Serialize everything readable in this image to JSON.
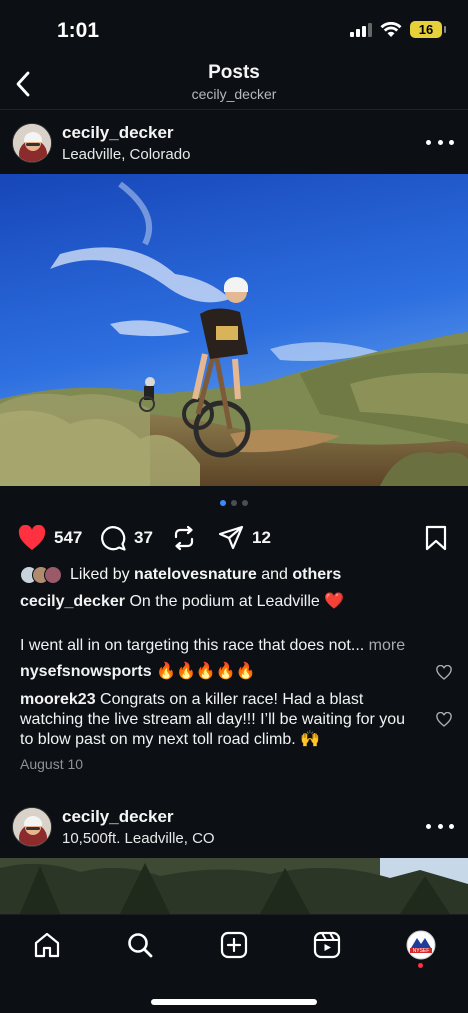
{
  "status": {
    "time": "1:01",
    "battery": "16"
  },
  "header": {
    "title": "Posts",
    "subtitle": "cecily_decker"
  },
  "post1": {
    "author": "cecily_decker",
    "location": "Leadville, Colorado",
    "carousel": {
      "count": 3,
      "active": 1
    },
    "likes_count": "547",
    "comments_count": "37",
    "shares_count": "12",
    "liked_by_prefix": "Liked by",
    "liked_by_user": "natelovesnature",
    "liked_by_and": "and",
    "liked_by_others": "others",
    "caption_author": "cecily_decker",
    "caption_text": "On the podium at Leadville ❤️",
    "caption_more_text": "I went all in on targeting this race that does not...",
    "more_label": "more",
    "comments": [
      {
        "user": "nysefsnowsports",
        "text": "🔥🔥🔥🔥🔥"
      },
      {
        "user": "moorek23",
        "text": "Congrats on a killer race! Had a blast watching the live stream all day!!! I’ll be waiting for you to blow past on my next toll road climb. 🙌"
      }
    ],
    "date": "August 10"
  },
  "post2": {
    "author": "cecily_decker",
    "location": "10,500ft. Leadville, CO"
  },
  "profile_badge": "NYSEF",
  "colors": {
    "like_red": "#ff3040",
    "accent_blue": "#3a8bff",
    "background": "#0c1014"
  }
}
